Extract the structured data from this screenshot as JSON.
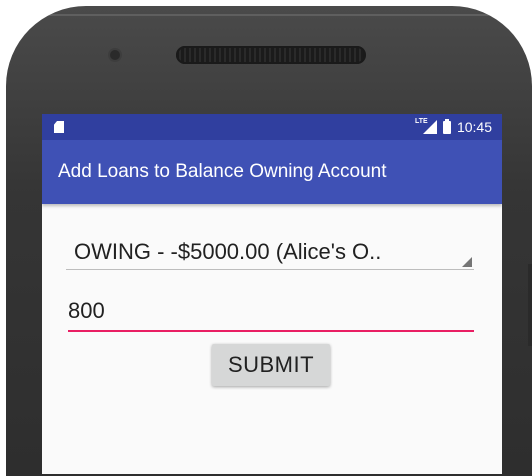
{
  "status_bar": {
    "time": "10:45",
    "network_badge": "LTE",
    "icons": [
      "sd-card-icon",
      "lte-signal-icon",
      "battery-icon"
    ]
  },
  "toolbar": {
    "title": "Add Loans to Balance Owning Account"
  },
  "form": {
    "account_spinner_value": "OWING - -$5000.00 (Alice's O..",
    "amount_value": "800",
    "submit_label": "SUBMIT"
  },
  "colors": {
    "toolbar": "#3f51b5",
    "status_bar": "#303f9f",
    "accent": "#e91e63",
    "button": "#d6d7d7"
  }
}
